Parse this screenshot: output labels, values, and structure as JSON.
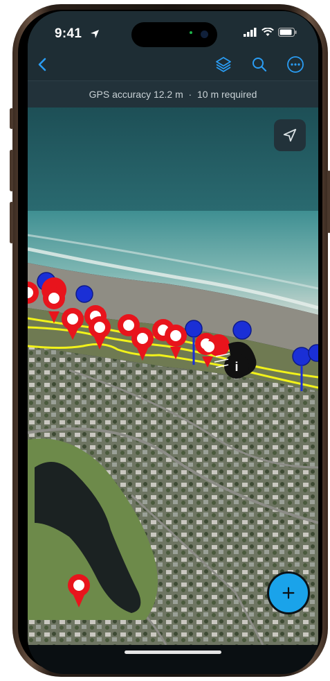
{
  "status_bar": {
    "time": "9:41"
  },
  "nav": {
    "back_icon": "chevron-left-icon",
    "layers_icon": "layers-icon",
    "search_icon": "search-icon",
    "more_icon": "ellipsis-circle-icon"
  },
  "gps": {
    "accuracy_text": "GPS accuracy 12.2 m  ·  10 m required"
  },
  "map": {
    "locate_icon": "location-arrow-icon",
    "add_icon": "plus-icon",
    "marker_colors": {
      "red": "#e8141c",
      "blue": "#1a2fd6",
      "boundary": "#f2f21a"
    }
  },
  "colors": {
    "accent": "#2a9df4",
    "fab": "#1aa3ea",
    "bar": "#1e2d34"
  }
}
